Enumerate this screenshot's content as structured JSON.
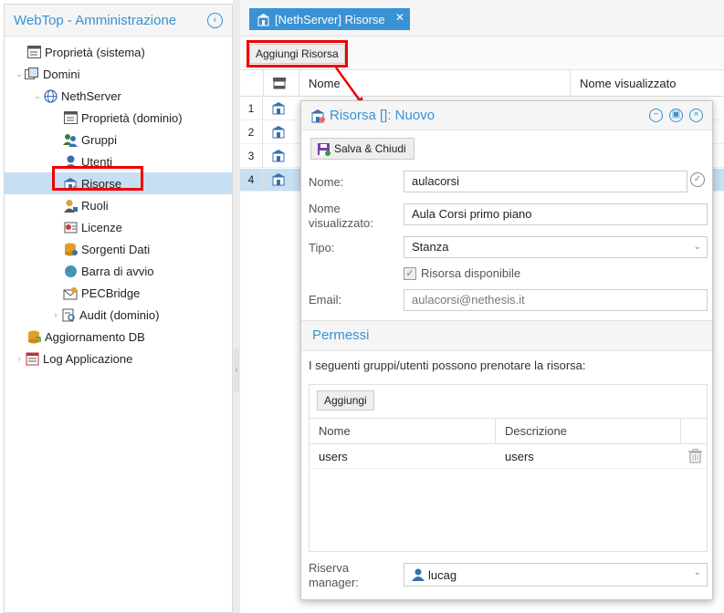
{
  "sidebar": {
    "title": "WebTop - Amministrazione",
    "items": [
      {
        "label": "Proprietà (sistema)"
      },
      {
        "label": "Domini"
      },
      {
        "label": "NethServer"
      },
      {
        "label": "Proprietà (dominio)"
      },
      {
        "label": "Gruppi"
      },
      {
        "label": "Utenti"
      },
      {
        "label": "Risorse"
      },
      {
        "label": "Ruoli"
      },
      {
        "label": "Licenze"
      },
      {
        "label": "Sorgenti Dati"
      },
      {
        "label": "Barra di avvio"
      },
      {
        "label": "PECBridge"
      },
      {
        "label": "Audit (dominio)"
      },
      {
        "label": "Aggiornamento DB"
      },
      {
        "label": "Log Applicazione"
      }
    ]
  },
  "tab": {
    "label": "[NethServer] Risorse",
    "close": "✕"
  },
  "toolbar": {
    "add_label": "Aggiungi Risorsa"
  },
  "grid": {
    "col_name": "Nome",
    "col_display": "Nome visualizzato",
    "rows": [
      {
        "n": "1"
      },
      {
        "n": "2"
      },
      {
        "n": "3"
      },
      {
        "n": "4"
      }
    ]
  },
  "dialog": {
    "title": "Risorsa []: Nuovo",
    "save_label": "Salva & Chiudi",
    "name_label": "Nome:",
    "name_value": "aulacorsi",
    "display_label": "Nome visualizzato:",
    "display_value": "Aula Corsi primo piano",
    "type_label": "Tipo:",
    "type_value": "Stanza",
    "available_label": "Risorsa disponibile",
    "email_label": "Email:",
    "email_value": "aulacorsi@nethesis.it",
    "permissions_title": "Permessi",
    "permissions_desc": "I seguenti gruppi/utenti possono prenotare la risorsa:",
    "add_label": "Aggiungi",
    "col_name": "Nome",
    "col_desc": "Descrizione",
    "perm_rows": [
      {
        "name": "users",
        "desc": "users"
      }
    ],
    "manager_label": "Riserva manager:",
    "manager_value": "lucag"
  },
  "colors": {
    "accent": "#3892d4",
    "highlight": "#e00000",
    "selection": "#c7dff3"
  }
}
